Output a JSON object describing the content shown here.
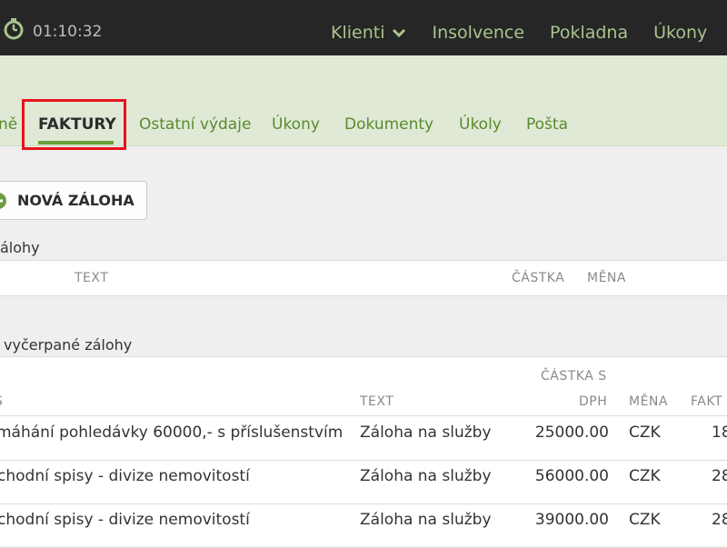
{
  "topbar": {
    "timer_icon": "stopwatch-icon",
    "timer": "01:10:32",
    "nav": [
      {
        "label": "Klienti"
      },
      {
        "label": "Insolvence"
      },
      {
        "label": "Pokladna"
      },
      {
        "label": "Úkony"
      }
    ],
    "accent_color": "#a7c48d"
  },
  "tabs": [
    {
      "label": "ně"
    },
    {
      "label": "FAKTURY",
      "active": true
    },
    {
      "label": "Ostatní výdaje"
    },
    {
      "label": "Úkony"
    },
    {
      "label": "Dokumenty"
    },
    {
      "label": "Úkoly"
    },
    {
      "label": "Pošta"
    }
  ],
  "new_advance_button": {
    "label": "NOVÁ ZÁLOHA",
    "icon": "plus-circle-icon"
  },
  "section1": {
    "title": "álohy",
    "columns": [
      "TEXT",
      "ČÁSTKA",
      "MĚNA"
    ]
  },
  "section2": {
    "title": "vyčerpané zálohy",
    "columns": {
      "first": "S",
      "text": "TEXT",
      "amount_line1": "ČÁSTKA S",
      "amount_line2": "DPH",
      "currency": "MĚNA",
      "invoice": "FAKT"
    },
    "rows": [
      {
        "name": "máhání pohledávky 60000,- s příslušenstvím",
        "text": "Záloha na služby",
        "amount": "25000.00",
        "currency": "CZK",
        "invoice": "18"
      },
      {
        "name": "chodní spisy - divize nemovitostí",
        "text": "Záloha na služby",
        "amount": "56000.00",
        "currency": "CZK",
        "invoice": "28"
      },
      {
        "name": "chodní spisy - divize nemovitostí",
        "text": "Záloha na služby",
        "amount": "39000.00",
        "currency": "CZK",
        "invoice": "28"
      }
    ]
  }
}
